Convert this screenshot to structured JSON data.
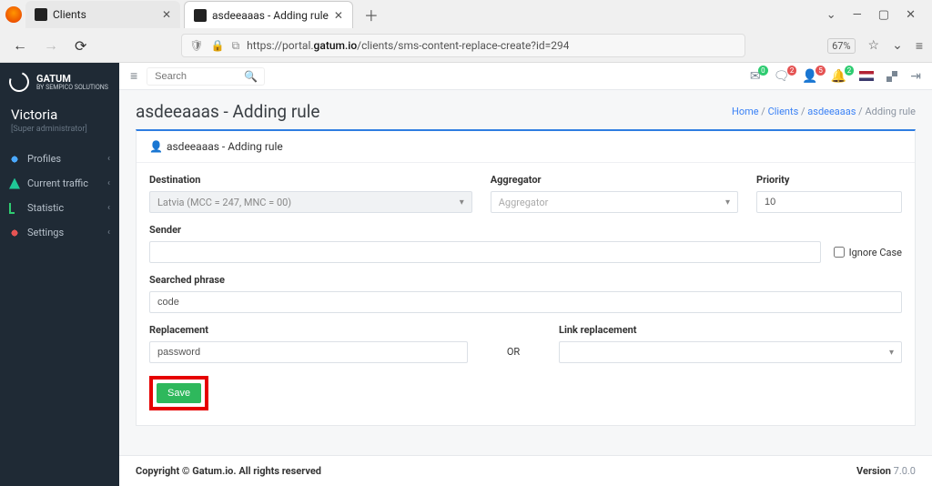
{
  "browser": {
    "tabs": [
      {
        "title": "Clients",
        "active": false
      },
      {
        "title": "asdeeaaas - Adding rule",
        "active": true
      }
    ],
    "url_prefix": "https://portal.",
    "url_domain": "gatum.io",
    "url_path": "/clients/sms-content-replace-create?id=294",
    "zoom": "67%"
  },
  "sidebar": {
    "brand": "GATUM",
    "brand_sub": "BY SEMPICO SOLUTIONS",
    "username": "Victoria",
    "role": "[Super administrator]",
    "items": [
      {
        "label": "Profiles"
      },
      {
        "label": "Current traffic"
      },
      {
        "label": "Statistic"
      },
      {
        "label": "Settings"
      }
    ]
  },
  "topbar": {
    "search_placeholder": "Search",
    "indicators": [
      {
        "count": "0",
        "color": "green"
      },
      {
        "count": "2",
        "color": "red"
      },
      {
        "count": "5",
        "color": "red"
      },
      {
        "count": "2",
        "color": "green"
      }
    ]
  },
  "page": {
    "title": "asdeeaaas - Adding rule",
    "breadcrumb": {
      "home": "Home",
      "clients": "Clients",
      "client": "asdeeaaas",
      "current": "Adding rule"
    }
  },
  "form": {
    "card_title": "asdeeaaas - Adding rule",
    "destination_label": "Destination",
    "destination_value": "Latvia (MCC = 247, MNC = 00)",
    "aggregator_label": "Aggregator",
    "aggregator_placeholder": "Aggregator",
    "priority_label": "Priority",
    "priority_value": "10",
    "sender_label": "Sender",
    "sender_value": "",
    "ignore_case_label": "Ignore Case",
    "searched_label": "Searched phrase",
    "searched_value": "code",
    "replacement_label": "Replacement",
    "replacement_value": "password",
    "or_label": "OR",
    "link_label": "Link replacement",
    "save_label": "Save"
  },
  "footer": {
    "copyright": "Copyright © Gatum.io. All rights reserved",
    "version_label": "Version ",
    "version": "7.0.0"
  }
}
